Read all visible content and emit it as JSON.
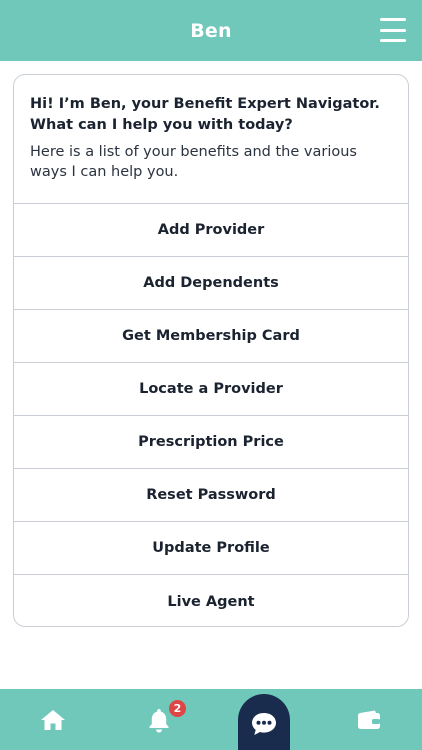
{
  "header": {
    "title": "Ben",
    "menu_icon": "hamburger-menu-icon"
  },
  "intro": {
    "greeting": "Hi! I’m Ben, your Benefit Expert Navigator. What can I help you with today?",
    "subtext": "Here is a list of your benefits and the various ways I can help you."
  },
  "options": [
    {
      "label": "Add Provider"
    },
    {
      "label": "Add Dependents"
    },
    {
      "label": "Get Membership Card"
    },
    {
      "label": "Locate a Provider"
    },
    {
      "label": "Prescription Price"
    },
    {
      "label": "Reset Password"
    },
    {
      "label": "Update Profile"
    },
    {
      "label": "Live Agent"
    }
  ],
  "bottom_nav": {
    "items": [
      {
        "icon": "home-icon"
      },
      {
        "icon": "bell-icon",
        "badge": "2"
      },
      {
        "icon": "chat-bubble-icon",
        "active": true
      },
      {
        "icon": "wallet-icon"
      }
    ]
  },
  "colors": {
    "header": "#6fc8ba",
    "active_tab": "#1a2c4e",
    "badge": "#e04545",
    "border": "#c9cfd5"
  }
}
